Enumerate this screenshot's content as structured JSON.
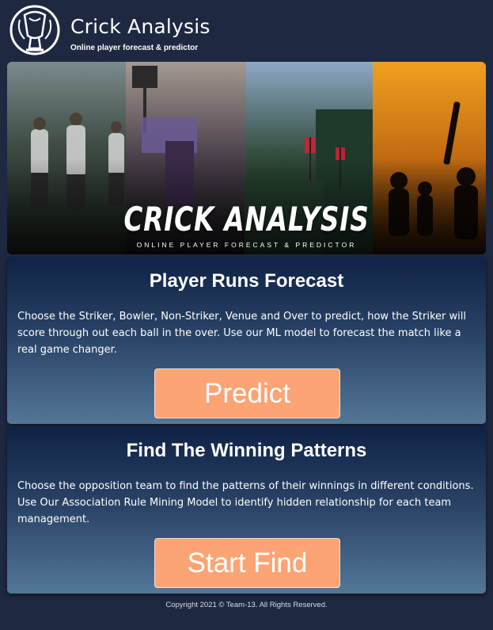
{
  "header": {
    "title": "Crick Analysis",
    "subtitle": "Online player forecast & predictor",
    "logo_icon": "trophy-logo-icon"
  },
  "banner": {
    "title": "CRICK ANALYSIS",
    "subtitle": "ONLINE PLAYER FORECAST & PREDICTOR"
  },
  "cards": [
    {
      "title": "Player Runs Forecast",
      "description": "Choose the Striker, Bowler, Non-Striker, Venue and Over to predict, how the Striker will score through out each ball in the over. Use our ML model to forecast the match like a real game changer.",
      "button_label": "Predict"
    },
    {
      "title": "Find The Winning Patterns",
      "description": "Choose the opposition team to find the patterns of their winnings in different conditions. Use Our Association Rule Mining Model to identify hidden relationship for each team management.",
      "button_label": "Start Find"
    }
  ],
  "footer": {
    "copyright": "Copyright 2021 © Team-13. All Rights Reserved."
  },
  "colors": {
    "background": "#1e2841",
    "button": "#fca474",
    "card_top": "#0f2245",
    "card_bottom": "#547797"
  }
}
